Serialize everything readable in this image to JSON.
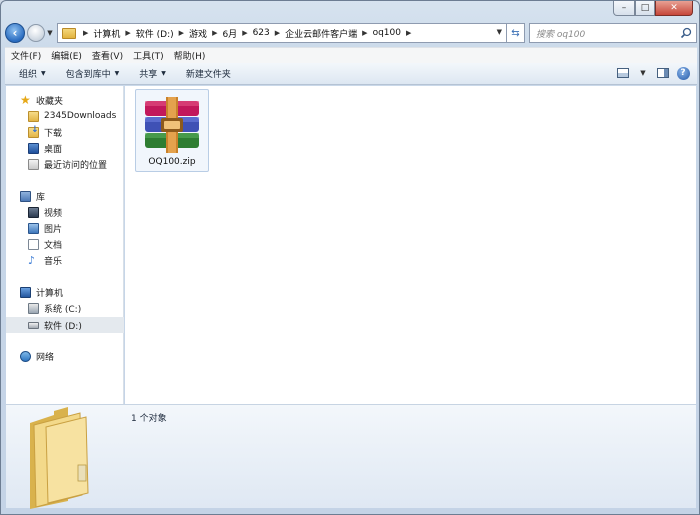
{
  "window": {
    "caption": {
      "minimize": "–",
      "maximize": "□",
      "close": "✕"
    }
  },
  "navigation": {
    "back_icon": "back-arrow-icon",
    "breadcrumbs": [
      "计算机",
      "软件 (D:)",
      "游戏",
      "6月",
      "623",
      "企业云邮件客户端",
      "oq100"
    ],
    "search_placeholder": "搜索 oq100"
  },
  "menu": {
    "items": [
      "文件(F)",
      "编辑(E)",
      "查看(V)",
      "工具(T)",
      "帮助(H)"
    ]
  },
  "toolbar": {
    "organize": "组织",
    "include_in_library": "包含到库中",
    "share": "共享",
    "new_folder": "新建文件夹"
  },
  "sidebar": {
    "favorites": {
      "label": "收藏夹",
      "items": [
        "2345Downloads",
        "下载",
        "桌面",
        "最近访问的位置"
      ]
    },
    "libraries": {
      "label": "库",
      "items": [
        "视频",
        "图片",
        "文档",
        "音乐"
      ]
    },
    "computer": {
      "label": "计算机",
      "items": [
        "系统 (C:)",
        "软件 (D:)"
      ],
      "selected": "软件 (D:)"
    },
    "network": {
      "label": "网络"
    }
  },
  "files": [
    {
      "name": "OQ100.zip",
      "icon": "winrar-archive-icon"
    }
  ],
  "details": {
    "count": "1 个对象"
  },
  "colors": {
    "accent": "#2a6cc0",
    "selected_bg": "#e4e9ee"
  }
}
